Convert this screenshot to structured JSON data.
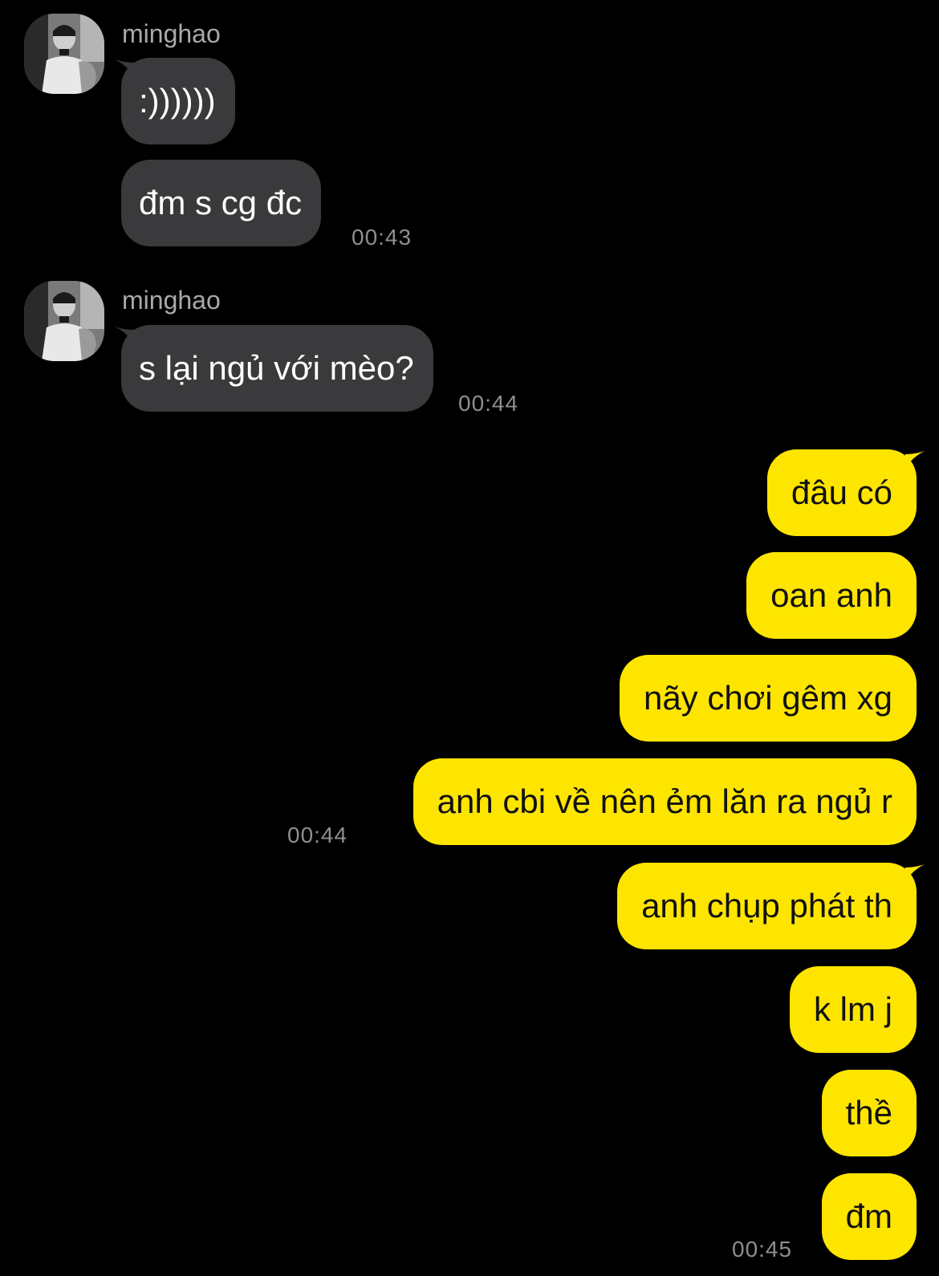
{
  "messages": {
    "group1": {
      "sender": "minghao",
      "bubble1": ":))))))",
      "bubble2": "đm s cg đc",
      "time": "00:43"
    },
    "group2": {
      "sender": "minghao",
      "bubble1": "s lại ngủ với mèo?",
      "time": "00:44"
    },
    "outgoing1": {
      "bubble1": "đâu có",
      "bubble2": "oan anh",
      "bubble3": "nãy chơi gêm xg",
      "bubble4": "anh cbi về nên ẻm lăn ra ngủ r",
      "time": "00:44"
    },
    "outgoing2": {
      "bubble1": "anh chụp phát th",
      "bubble2": "k lm j",
      "bubble3": "thề",
      "bubble4": "đm",
      "time": "00:45"
    }
  },
  "colors": {
    "background": "#000000",
    "incoming_bubble": "#3a3a3c",
    "outgoing_bubble": "#fee500",
    "timestamp": "#8e8e93",
    "sender_name": "#a9a9a9"
  },
  "icons": {
    "avatar": "profile-photo-avatar"
  }
}
